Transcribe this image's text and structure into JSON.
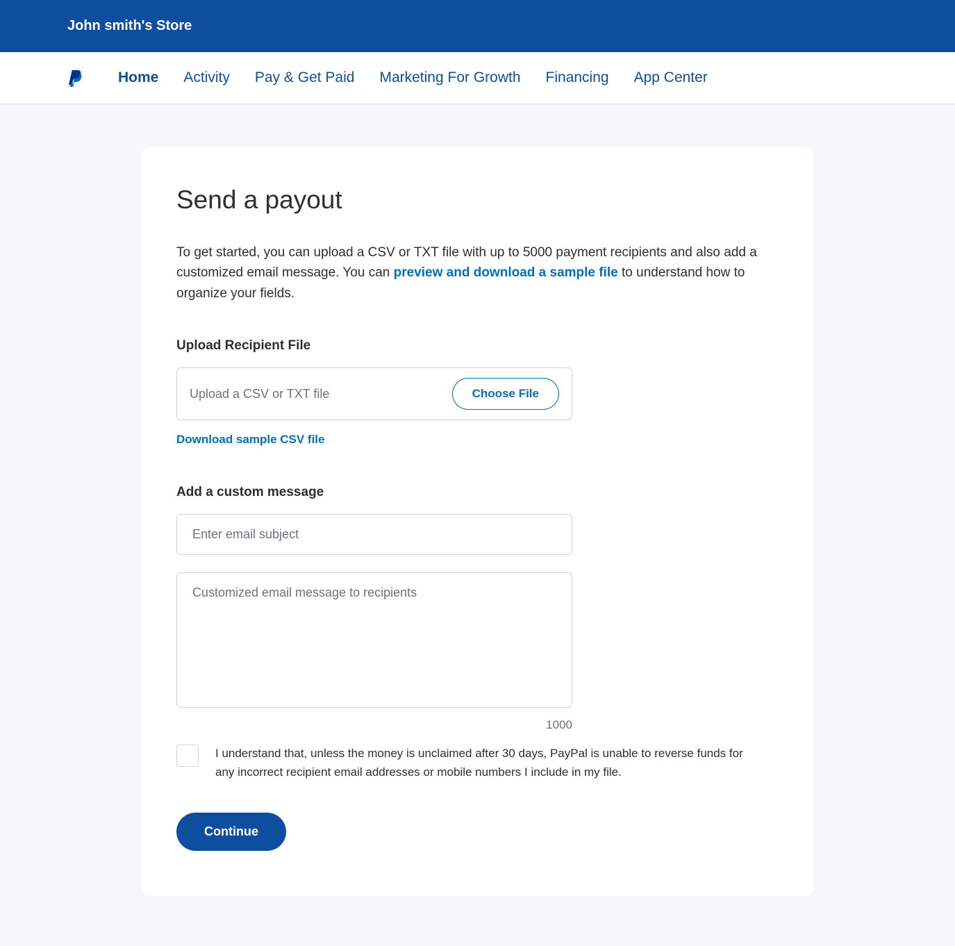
{
  "header": {
    "store_name": "John smith's Store"
  },
  "nav": {
    "items": [
      {
        "label": "Home",
        "bold": true
      },
      {
        "label": "Activity",
        "bold": false
      },
      {
        "label": "Pay & Get Paid",
        "bold": false
      },
      {
        "label": "Marketing For Growth",
        "bold": false
      },
      {
        "label": "Financing",
        "bold": false
      },
      {
        "label": "App Center",
        "bold": false
      }
    ]
  },
  "page": {
    "title": "Send a payout",
    "description_prefix": "To get started, you can upload a CSV or TXT file with up to 5000 payment recipients and also add a customized email message. You can ",
    "description_link": "preview and download a sample file",
    "description_suffix": " to understand how to organize your fields."
  },
  "upload": {
    "heading": "Upload Recipient File",
    "placeholder": "Upload a CSV or TXT file",
    "button_label": "Choose File",
    "download_link": "Download sample CSV file"
  },
  "message": {
    "heading": "Add a custom message",
    "subject_placeholder": "Enter email subject",
    "body_placeholder": "Customized email message to recipients",
    "char_count": "1000"
  },
  "consent": {
    "text": "I understand that, unless the money is unclaimed after 30 days, PayPal is unable to reverse funds for any incorrect recipient email addresses or mobile numbers I include in my file."
  },
  "actions": {
    "continue_label": "Continue"
  }
}
